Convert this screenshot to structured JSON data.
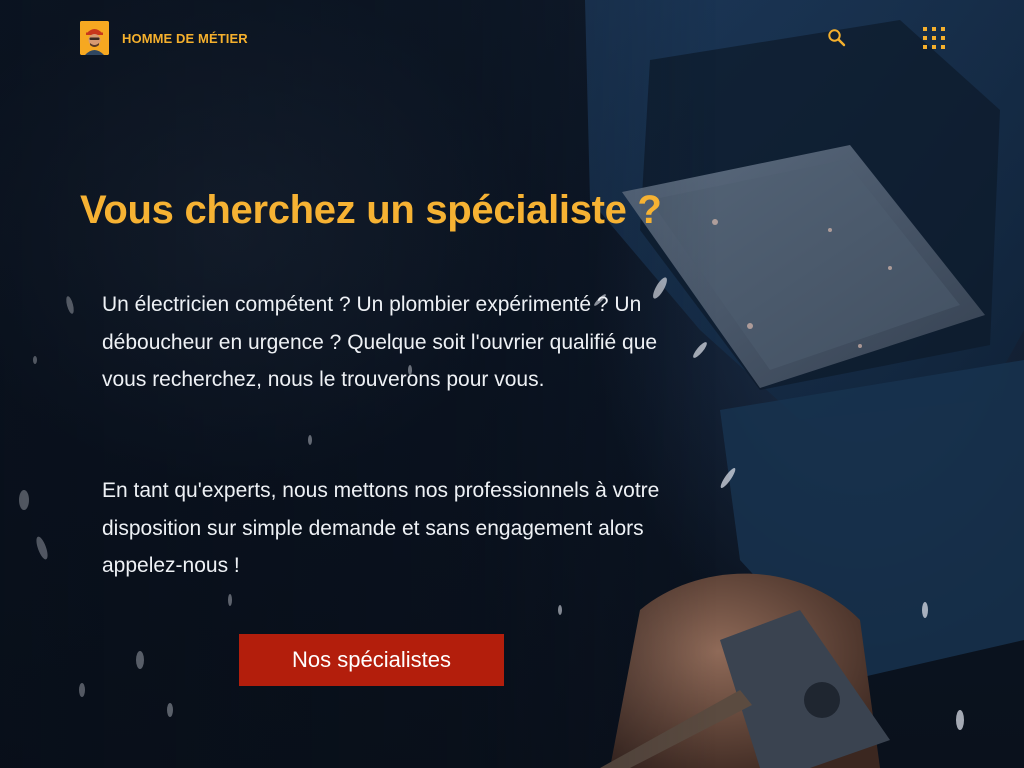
{
  "header": {
    "brand_name": "HOMME DE MÉTIER",
    "logo_icon": "worker-face-icon",
    "search_icon": "search-icon",
    "menu_icon": "grid-menu-icon"
  },
  "hero": {
    "title": "Vous cherchez un spécialiste ?",
    "paragraph_1": "Un électricien compétent ? Un plombier expérimenté ? Un déboucheur en urgence ? Quelque soit l'ouvrier qualifié que vous recherchez, nous le trouverons pour vous.",
    "paragraph_2": "En tant qu'experts, nous mettons nos professionnels à votre disposition sur simple demande et sans engagement alors appelez-nous !",
    "cta_label": "Nos spécialistes",
    "background_subject": "welder-with-helmet-and-sparks"
  },
  "colors": {
    "accent": "#f6b233",
    "button": "#b31e0c",
    "background": "#0c1523",
    "text": "#eef1f5"
  }
}
